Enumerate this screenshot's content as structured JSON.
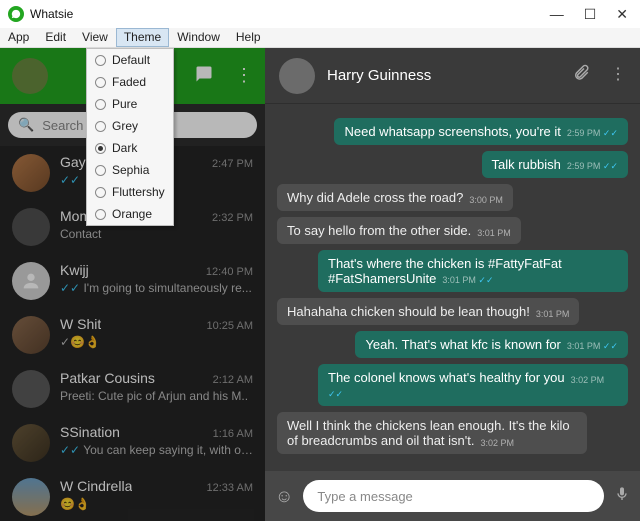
{
  "window": {
    "title": "Whatsie"
  },
  "menubar": [
    "App",
    "Edit",
    "View",
    "Theme",
    "Window",
    "Help"
  ],
  "menubar_selected": 3,
  "theme_menu": [
    {
      "label": "Default",
      "selected": false
    },
    {
      "label": "Faded",
      "selected": false
    },
    {
      "label": "Pure",
      "selected": false
    },
    {
      "label": "Grey",
      "selected": false
    },
    {
      "label": "Dark",
      "selected": true
    },
    {
      "label": "Sephia",
      "selected": false
    },
    {
      "label": "Fluttershy",
      "selected": false
    },
    {
      "label": "Orange",
      "selected": false
    }
  ],
  "search": {
    "placeholder": "Search"
  },
  "chats": [
    {
      "name": "Gay",
      "time": "2:47 PM",
      "preview": "",
      "ticks": true,
      "av": "c1"
    },
    {
      "name": "Mom",
      "time": "2:32 PM",
      "preview": "Contact",
      "ticks": false,
      "av": "c2"
    },
    {
      "name": "Kwijj",
      "time": "12:40 PM",
      "preview": "I'm going to simultaneously re...",
      "ticks": true,
      "av": "grey"
    },
    {
      "name": "W Shit",
      "time": "10:25 AM",
      "preview": "✓😊👌",
      "ticks": false,
      "av": "c4"
    },
    {
      "name": "Patkar Cousins",
      "time": "2:12 AM",
      "preview": "Preeti: Cute pic of Arjun and his M..",
      "ticks": false,
      "av": "c5"
    },
    {
      "name": "SSination",
      "time": "1:16 AM",
      "preview": "You can keep saying it, with or...",
      "ticks": true,
      "av": "c6"
    },
    {
      "name": "W Cindrella",
      "time": "12:33 AM",
      "preview": "😊👌",
      "ticks": false,
      "av": "c7"
    }
  ],
  "thread": {
    "name": "Harry Guinness",
    "messages": [
      {
        "dir": "out",
        "text": "Need whatsapp screenshots, you're it",
        "time": "2:59 PM",
        "ticks": true
      },
      {
        "dir": "out",
        "text": "Talk rubbish",
        "time": "2:59 PM",
        "ticks": true
      },
      {
        "dir": "in",
        "text": "Why did Adele cross the road?",
        "time": "3:00 PM"
      },
      {
        "dir": "in",
        "text": "To say hello from the other side.",
        "time": "3:01 PM"
      },
      {
        "dir": "out",
        "text": "That's where the chicken is #FattyFatFat #FatShamersUnite",
        "time": "3:01 PM",
        "ticks": true
      },
      {
        "dir": "in",
        "text": "Hahahaha chicken should be lean though!",
        "time": "3:01 PM"
      },
      {
        "dir": "out",
        "text": "Yeah. That's what kfc is known for",
        "time": "3:01 PM",
        "ticks": true
      },
      {
        "dir": "out",
        "text": "The colonel knows what's healthy for you",
        "time": "3:02 PM",
        "ticks": true
      },
      {
        "dir": "in",
        "text": "Well I think the chickens lean enough. It's the kilo of breadcrumbs and oil that isn't.",
        "time": "3:02 PM"
      }
    ],
    "composer_placeholder": "Type a message"
  }
}
